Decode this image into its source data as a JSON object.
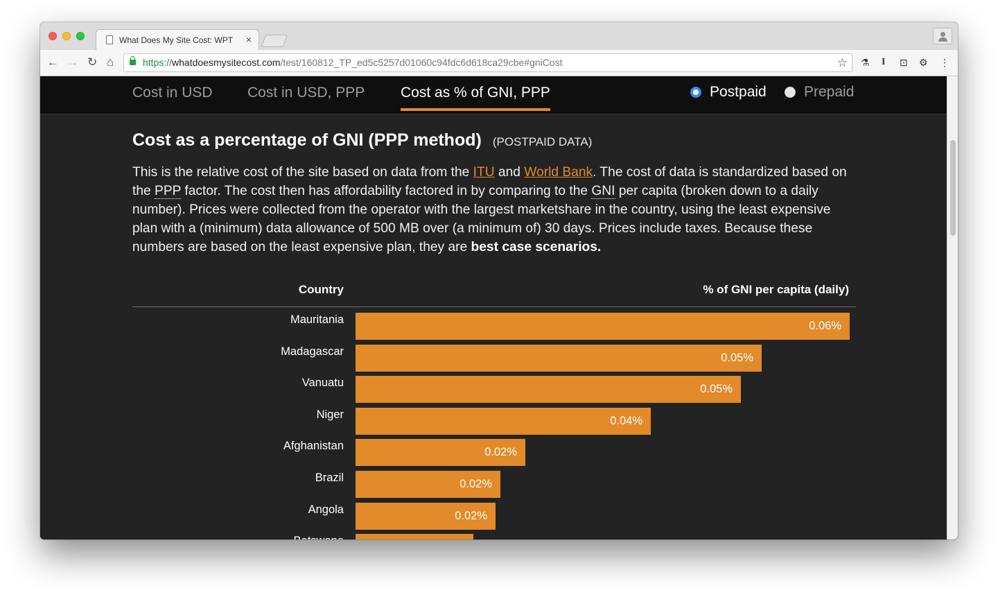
{
  "browser": {
    "tab_title": "What Does My Site Cost: WPT",
    "tab_close": "×",
    "url_scheme": "https://",
    "url_host": "whatdoesmysitecost.com",
    "url_path": "/test/160812_TP_ed5c5257d01060c94fdc6d618ca29cbe#gniCost",
    "nav": {
      "back": "←",
      "forward": "→",
      "reload": "↻",
      "home": "⌂"
    },
    "star": "☆",
    "extensions": [
      "evernote-icon",
      "instapaper-icon",
      "badge-icon",
      "gear-icon",
      "menu-icon"
    ],
    "ext_glyphs": [
      "⚗",
      "I",
      "⊡",
      "⚙",
      "⋮"
    ]
  },
  "subnav": {
    "tabs": [
      {
        "label": "Cost in USD"
      },
      {
        "label": "Cost in USD, PPP"
      },
      {
        "label": "Cost as % of GNI, PPP"
      }
    ],
    "active_tab": 2,
    "radios": [
      {
        "label": "Postpaid",
        "checked": true
      },
      {
        "label": "Prepaid",
        "checked": false
      }
    ]
  },
  "main": {
    "heading": "Cost as a percentage of GNI (PPP method)",
    "heading_sub": "(POSTPAID DATA)",
    "desc": {
      "p1": "This is the relative cost of the site based on data from the ",
      "link_itu": "ITU",
      "p2": " and ",
      "link_wb": "World Bank",
      "p3": ". The cost of data is standardized based on the ",
      "abbr_ppp": "PPP",
      "p4": " factor. The cost then has affordability factored in by comparing to the ",
      "abbr_gni": "GNI",
      "p5": " per capita (broken down to a daily number). Prices were collected from the operator with the largest marketshare in the country, using the least expensive plan with a (minimum) data allowance of 500 MB over (a minimum of) 30 days. Prices include taxes. Because these numbers are based on the least expensive plan, they are ",
      "bold": "best case scenarios."
    }
  },
  "chart_data": {
    "type": "bar",
    "orientation": "horizontal",
    "category_header": "Country",
    "value_header": "% of GNI per capita (daily)",
    "categories": [
      "Mauritania",
      "Madagascar",
      "Vanuatu",
      "Niger",
      "Afghanistan",
      "Brazil",
      "Angola",
      "Botswana"
    ],
    "values": [
      0.06,
      0.05,
      0.05,
      0.04,
      0.02,
      0.02,
      0.02,
      0.02
    ],
    "bar_fraction": [
      1.0,
      0.822,
      0.78,
      0.597,
      0.343,
      0.293,
      0.284,
      0.238
    ],
    "labels": [
      "0.06%",
      "0.05%",
      "0.05%",
      "0.04%",
      "0.02%",
      "0.02%",
      "0.02%",
      ""
    ],
    "color": "#e38a2a"
  }
}
